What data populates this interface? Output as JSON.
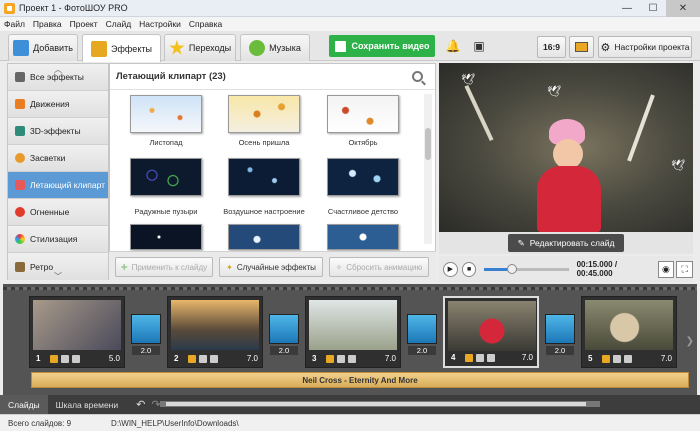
{
  "window": {
    "title": "Проект 1 - ФотоШОУ PRO",
    "minimize": "—",
    "maximize": "☐",
    "close": "✕"
  },
  "menu": [
    "Файл",
    "Правка",
    "Проект",
    "Слайд",
    "Настройки",
    "Справка"
  ],
  "tabs": [
    {
      "label": "Добавить"
    },
    {
      "label": "Эффекты"
    },
    {
      "label": "Переходы"
    },
    {
      "label": "Музыка"
    }
  ],
  "toolbar": {
    "save_label": "Сохранить видео",
    "ratio_label": "16:9",
    "project_settings_label": "Настройки проекта"
  },
  "categories": [
    {
      "label": "Все эффекты"
    },
    {
      "label": "Движения"
    },
    {
      "label": "3D-эффекты"
    },
    {
      "label": "Засветки"
    },
    {
      "label": "Летающий клипарт"
    },
    {
      "label": "Огненные"
    },
    {
      "label": "Стилизация"
    },
    {
      "label": "Ретро"
    }
  ],
  "effects_panel": {
    "title": "Летающий клипарт (23)",
    "items": [
      {
        "label": "Листопад"
      },
      {
        "label": "Осень пришла"
      },
      {
        "label": "Октябрь"
      },
      {
        "label": "Радужные пузыри"
      },
      {
        "label": "Воздушное настроение"
      },
      {
        "label": "Счастливое детство"
      }
    ]
  },
  "actions": {
    "apply": "Применить к слайду",
    "random": "Случайные эффекты",
    "reset": "Сбросить анимацию"
  },
  "preview": {
    "edit_label": "Редактировать слайд"
  },
  "player": {
    "time": "00:15.000 / 00:45.000",
    "progress": 0.33
  },
  "timeline": {
    "slides": [
      {
        "num": "1",
        "dur": "5.0"
      },
      {
        "num": "2",
        "dur": "7.0"
      },
      {
        "num": "3",
        "dur": "7.0"
      },
      {
        "num": "4",
        "dur": "7.0"
      },
      {
        "num": "5",
        "dur": "7.0"
      }
    ],
    "transitions": [
      {
        "dur": "2.0"
      },
      {
        "dur": "2.0"
      },
      {
        "dur": "2.0"
      },
      {
        "dur": "2.0"
      }
    ],
    "music": "Neil Cross - Eternity And More"
  },
  "bottom": {
    "tab_slides": "Слайды",
    "tab_timeline": "Шкала времени"
  },
  "status": {
    "count": "Всего слайдов: 9",
    "path": "D:\\WIN_HELP\\UserInfo\\Downloads\\"
  }
}
